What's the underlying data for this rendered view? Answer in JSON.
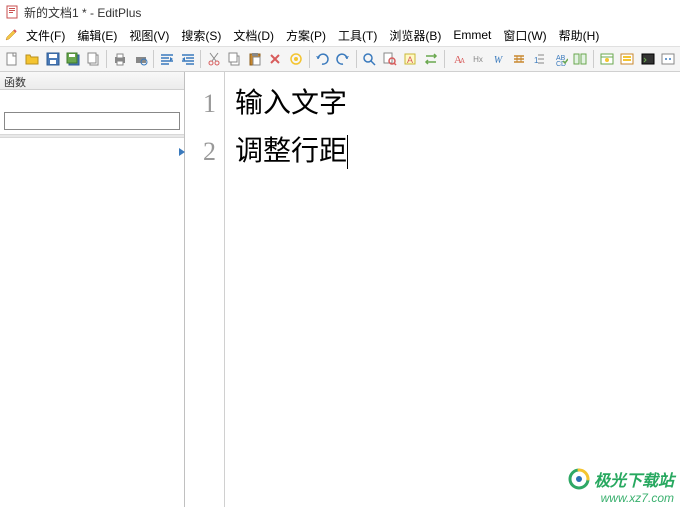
{
  "title": "新的文档1 * - EditPlus",
  "menus": {
    "file": "文件(F)",
    "edit": "编辑(E)",
    "view": "视图(V)",
    "search": "搜索(S)",
    "document": "文档(D)",
    "project": "方案(P)",
    "tool": "工具(T)",
    "browser": "浏览器(B)",
    "emmet": "Emmet",
    "window": "窗口(W)",
    "help": "帮助(H)"
  },
  "sidebar": {
    "header": "函数",
    "input_value": ""
  },
  "editor": {
    "lines": [
      {
        "num": "1",
        "text": "输入文字",
        "current": false
      },
      {
        "num": "2",
        "text": "调整行距",
        "current": true
      }
    ]
  },
  "watermark": {
    "brand": "极光下载站",
    "url": "www.xz7.com"
  },
  "toolbar_icons": [
    "new-file-icon",
    "open-folder-icon",
    "save-icon",
    "save-all-icon",
    "copy-doc-icon",
    "sep",
    "print-icon",
    "print-preview-icon",
    "sep",
    "indent-left-icon",
    "indent-right-icon",
    "sep",
    "cut-icon",
    "copy-icon",
    "paste-icon",
    "delete-icon",
    "bookmark-icon",
    "sep",
    "undo-icon",
    "redo-icon",
    "sep",
    "find-icon",
    "find-in-files-icon",
    "highlight-icon",
    "replace-icon",
    "sep",
    "font-size-icon",
    "hex-icon",
    "word-wrap-icon",
    "ruler-icon",
    "line-number-icon",
    "spell-check-icon",
    "column-marker-icon",
    "sep",
    "browser-view-icon",
    "preview-icon",
    "terminal-icon",
    "settings-icon"
  ],
  "colors": {
    "accent": "#3a7abd",
    "toolbar_bg": "#f5f5f5",
    "gutter_text": "#999999"
  }
}
